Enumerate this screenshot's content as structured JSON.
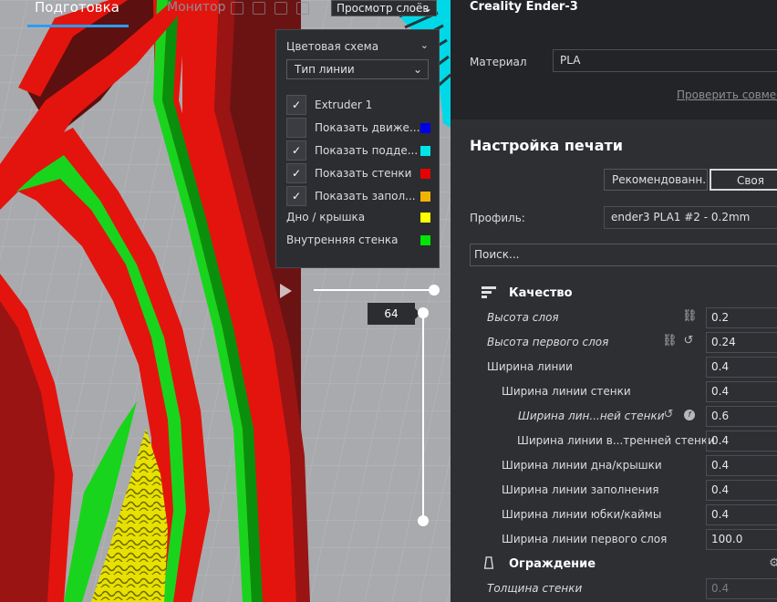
{
  "header": {
    "tab_prepare": "Подготовка",
    "tab_monitor": "Монитор",
    "view_mode": "Просмотр слоёв"
  },
  "color_scheme": {
    "title": "Цветовая схема",
    "selected": "Тип линии",
    "items": [
      {
        "label": "Extruder 1",
        "checked": true,
        "color": ""
      },
      {
        "label": "Показать движе...",
        "checked": false,
        "color": "#0000e6"
      },
      {
        "label": "Показать подде...",
        "checked": true,
        "color": "#00e6e6"
      },
      {
        "label": "Показать стенки",
        "checked": true,
        "color": "#e60000"
      },
      {
        "label": "Показать запол...",
        "checked": true,
        "color": "#f0b400"
      }
    ],
    "legend": [
      {
        "label": "Дно / крышка",
        "color": "#ffff00"
      },
      {
        "label": "Внутренняя стенка",
        "color": "#00e600"
      }
    ]
  },
  "layer_slider": {
    "current_layer": "64"
  },
  "printer": {
    "name": "Creality Ender-3",
    "material_label": "Материал",
    "material_value": "PLA",
    "compat_link": "Проверить совместимость"
  },
  "print_setup": {
    "title": "Настройка печати",
    "mode_recommended": "Рекомендованн...",
    "mode_custom": "Своя",
    "profile_label": "Профиль:",
    "profile_value": "ender3 PLA1 #2 - 0.2mm",
    "search_placeholder": "Поиск..."
  },
  "sections": {
    "quality": "Качество",
    "shell": "Ограждение"
  },
  "settings": [
    {
      "name": "Высота слоя",
      "value": "0.2"
    },
    {
      "name": "Высота первого слоя",
      "value": "0.24"
    },
    {
      "name": "Ширина линии",
      "value": "0.4"
    },
    {
      "name": "Ширина линии стенки",
      "value": "0.4"
    },
    {
      "name": "Ширина лин...ней стенки",
      "value": "0.6"
    },
    {
      "name": "Ширина линии в...тренней стенки",
      "value": "0.4"
    },
    {
      "name": "Ширина линии дна/крышки",
      "value": "0.4"
    },
    {
      "name": "Ширина линии заполнения",
      "value": "0.4"
    },
    {
      "name": "Ширина линии юбки/каймы",
      "value": "0.4"
    },
    {
      "name": "Ширина линии первого слоя",
      "value": "100.0"
    },
    {
      "name": "Толщина стенки",
      "value": "0.4"
    }
  ]
}
